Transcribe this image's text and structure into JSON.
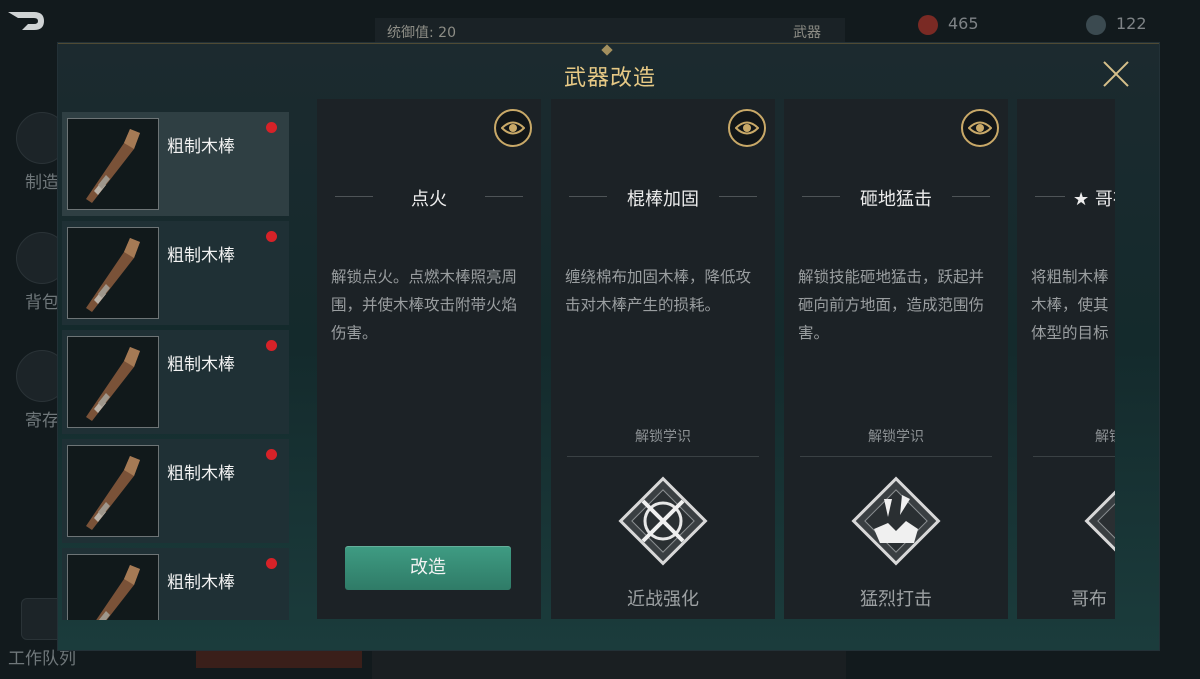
{
  "background": {
    "command_label": "统御值: 20",
    "tab_label": "武器",
    "res1_value": "465",
    "res2_value": "122",
    "side_items": [
      "制造",
      "背包",
      "寄存"
    ],
    "bottom_label": "工作队列"
  },
  "modal": {
    "title": "武器改造"
  },
  "weapon_list": [
    {
      "name": "粗制木棒",
      "selected": true
    },
    {
      "name": "粗制木棒",
      "selected": false
    },
    {
      "name": "粗制木棒",
      "selected": false
    },
    {
      "name": "粗制木棒",
      "selected": false
    },
    {
      "name": "粗制木棒",
      "selected": false
    }
  ],
  "cards": [
    {
      "title": "点火",
      "description": "解锁点火。点燃木棒照亮周围，并使木棒攻击附带火焰伤害。",
      "action_label": "改造"
    },
    {
      "title": "棍棒加固",
      "description": "缠绕棉布加固木棒，降低攻击对木棒产生的损耗。",
      "unlock_label": "解锁学识",
      "skill_name": "近战强化",
      "skill_icon": "crossed-swords-icon"
    },
    {
      "title": "砸地猛击",
      "description": "解锁技能砸地猛击，跃起并砸向前方地面，造成范围伤害。",
      "unlock_label": "解锁学识",
      "skill_name": "猛烈打击",
      "skill_icon": "ground-smash-icon"
    },
    {
      "title": "★ 哥布",
      "description": "将粗制木棒木棒，使其体型的目标",
      "unlock_label": "解锁",
      "skill_name": "哥布",
      "skill_icon": "goblin-skill-icon"
    }
  ],
  "colors": {
    "accent_gold": "#e7c985",
    "button_green": "#3f9c83",
    "notification_red": "#d62228"
  }
}
